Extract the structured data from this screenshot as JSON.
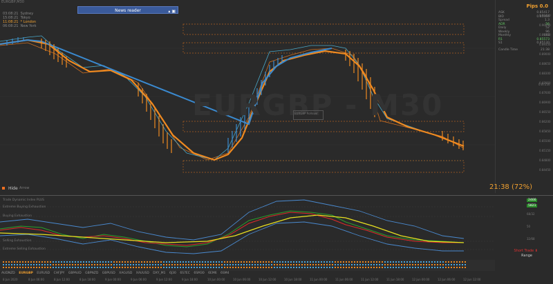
{
  "window_title": "EURGBP,M30",
  "news_reader": {
    "label": "News reader"
  },
  "sessions": [
    {
      "time": "03:08:21",
      "name": "Sydney",
      "active": false
    },
    {
      "time": "15:08:21",
      "name": "Tokyo",
      "active": false
    },
    {
      "time": "11:08:21",
      "name": "London",
      "active": true
    },
    {
      "time": "06:08:21",
      "name": "New York",
      "active": false
    }
  ],
  "watermark": "EURGBP - M30",
  "info_box": "EURGBP Rollover",
  "right_panel": {
    "pips": "Pips 0.0",
    "rows": [
      {
        "label": "ASK",
        "value": "0.85417"
      },
      {
        "label": "BID",
        "value": "0.85404"
      },
      {
        "label": "Spread",
        "value": "1.3"
      },
      {
        "label": "ADR",
        "value": "56"
      },
      {
        "label": "Daily",
        "value": "52"
      },
      {
        "label": "Weekly",
        "value": "96"
      },
      {
        "label": "Monthly",
        "value": "183"
      },
      {
        "label": "R1",
        "value": "0.85573"
      },
      {
        "label": "S1",
        "value": "0.85120"
      },
      {
        "label": "Candle Time",
        "value": "21:38"
      }
    ]
  },
  "controls": {
    "hide": "Hide",
    "arrow": "Arrow"
  },
  "countdown": "21:38 (72%)",
  "oscillator": {
    "title": "Trade Dynamic Index PLUS",
    "levels": [
      "Extreme Buying Exhaustion",
      "Buying Exhaustion",
      "Selling Exhaustion",
      "Extreme Selling Exhaustion"
    ],
    "badges": [
      {
        "value": "2466",
        "color": "#2a8a2a"
      },
      {
        "value": "5821",
        "color": "#2a8a2a"
      }
    ],
    "short_trade": "Short Trade",
    "range": "Range"
  },
  "symbol_tabs": [
    "AUDNZD",
    "EURGBP",
    "EURUSD",
    "CHFJPY",
    "GBPAUD",
    "GBPNZD",
    "GBPUSD",
    "XAGUSD",
    "XAUUSD",
    "DXY_M1",
    "6J30",
    "6S7EC",
    "6SM30",
    "6EM6",
    "6SM4"
  ],
  "active_tab": "EURGBP",
  "time_labels": [
    "8 Jun 2020",
    "8 Jun 06:00",
    "8 Jun 12:00",
    "8 Jun 18:00",
    "9 Jun 00:00",
    "9 Jun 06:00",
    "9 Jun 12:00",
    "9 Jun 18:00",
    "10 Jun 00:00",
    "10 Jun 06:00",
    "10 Jun 12:00",
    "10 Jun 18:00",
    "11 Jun 00:00",
    "11 Jun 06:00",
    "11 Jun 12:00",
    "11 Jun 18:00",
    "12 Jun 00:00",
    "12 Jun 06:00",
    "12 Jun 12:00"
  ],
  "price_labels": [
    "0.90400",
    "0.90050",
    "0.89700",
    "0.89350",
    "0.89000",
    "0.88650",
    "0.88300",
    "0.87950",
    "0.87600",
    "0.87250",
    "0.86900",
    "0.86550",
    "0.86200",
    "0.85850",
    "0.85500",
    "0.85150",
    "0.84800",
    "0.84450"
  ],
  "osc_labels": [
    "2466",
    "5821",
    "68/32",
    "50",
    "32/68"
  ]
}
